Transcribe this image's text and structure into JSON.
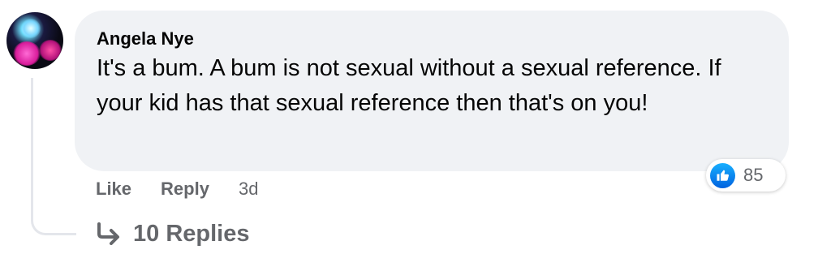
{
  "comment": {
    "author": "Angela Nye",
    "text": "It's a bum. A bum is not sexual without a sexual reference. If your kid has that sexual reference then that's on you!",
    "timestamp": "3d",
    "avatar_icon": "user-avatar"
  },
  "actions": {
    "like_label": "Like",
    "reply_label": "Reply"
  },
  "reactions": {
    "icon": "thumbs-up-icon",
    "count": "85",
    "color": "#0866ff"
  },
  "replies": {
    "icon": "reply-arrow-icon",
    "label": "10 Replies"
  },
  "colors": {
    "bubble": "#f0f2f5",
    "text": "#050505",
    "secondary": "#65676b"
  }
}
